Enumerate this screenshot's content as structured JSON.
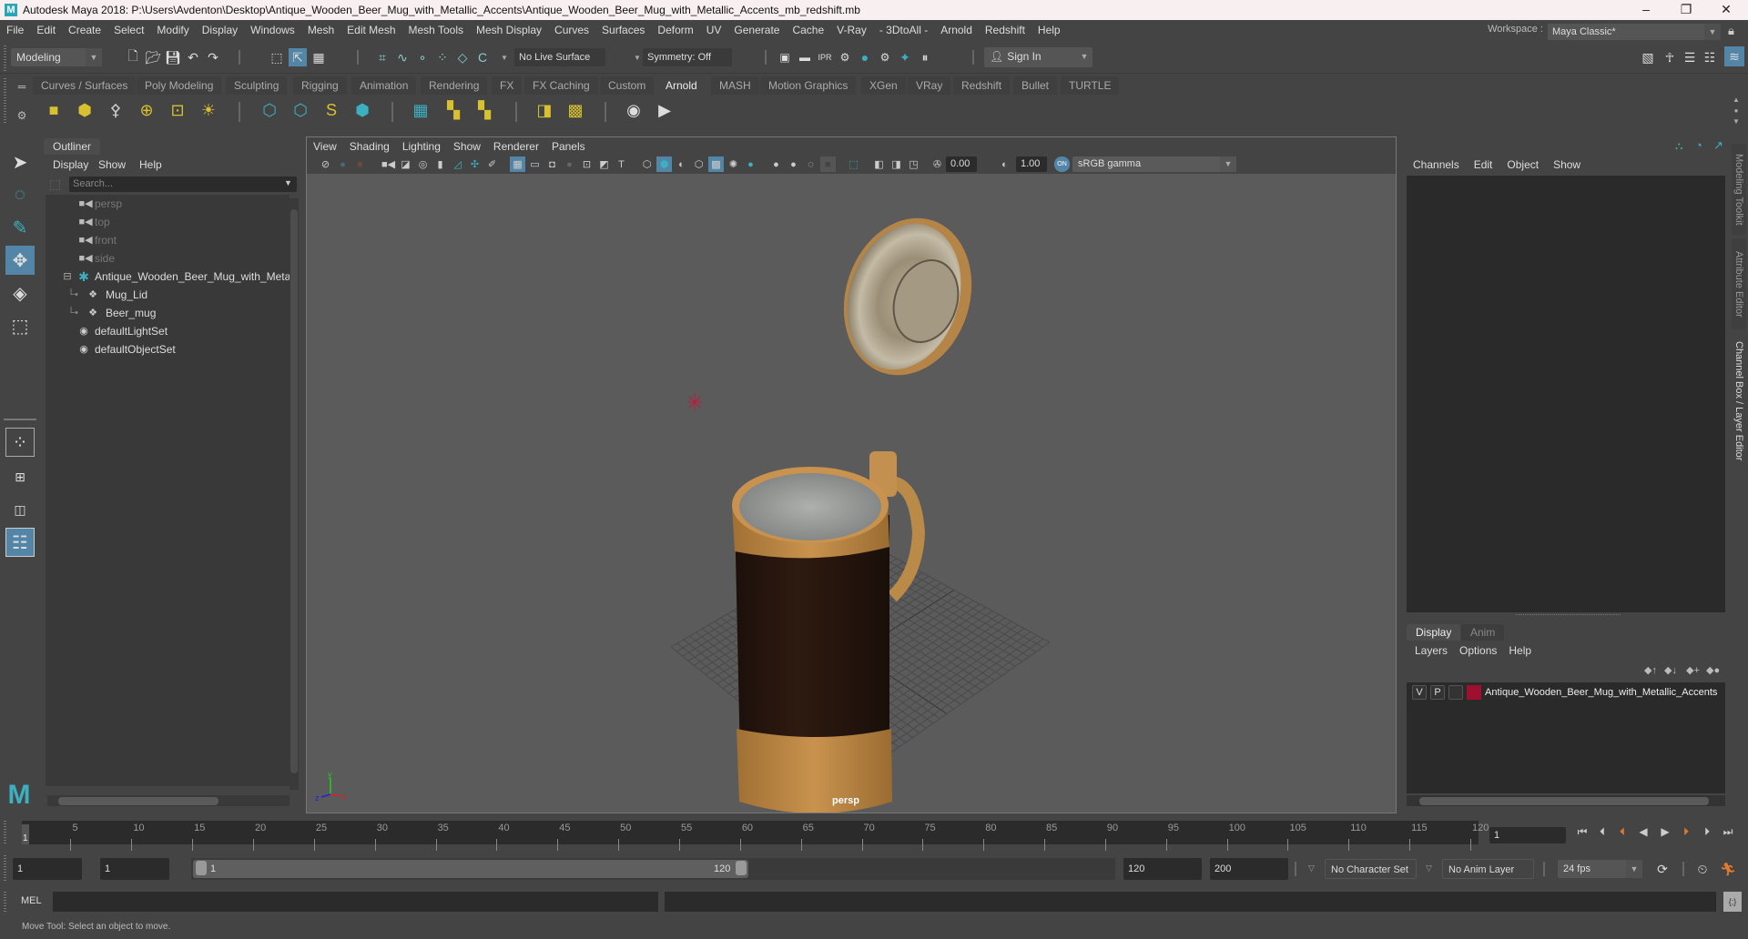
{
  "window": {
    "title": "Autodesk Maya 2018: P:\\Users\\Avdenton\\Desktop\\Antique_Wooden_Beer_Mug_with_Metallic_Accents\\Antique_Wooden_Beer_Mug_with_Metallic_Accents_mb_redshift.mb",
    "logo": "M",
    "controls": {
      "minimize": "–",
      "maximize": "❐",
      "close": "✕"
    }
  },
  "menubar": {
    "items": [
      "File",
      "Edit",
      "Create",
      "Select",
      "Modify",
      "Display",
      "Windows",
      "Mesh",
      "Edit Mesh",
      "Mesh Tools",
      "Mesh Display",
      "Curves",
      "Surfaces",
      "Deform",
      "UV",
      "Generate",
      "Cache",
      "V-Ray",
      "- 3DtoAll -",
      "Arnold",
      "Redshift",
      "Help"
    ],
    "workspace_label": "Workspace :",
    "workspace_value": "Maya Classic*"
  },
  "statusline": {
    "menuset": "Modeling",
    "live_surface": "No Live Surface",
    "symmetry": "Symmetry: Off",
    "sign_in": "Sign In"
  },
  "shelf": {
    "tabs": [
      "Curves / Surfaces",
      "Poly Modeling",
      "Sculpting",
      "Rigging",
      "Animation",
      "Rendering",
      "FX",
      "FX Caching",
      "Custom",
      "Arnold",
      "MASH",
      "Motion Graphics",
      "XGen",
      "VRay",
      "Redshift",
      "Bullet",
      "TURTLE"
    ],
    "active_tab": "Arnold"
  },
  "outliner": {
    "title": "Outliner",
    "menu": [
      "Display",
      "Show",
      "Help"
    ],
    "search_placeholder": "Search...",
    "items": [
      {
        "label": "persp",
        "type": "camera",
        "dim": true
      },
      {
        "label": "top",
        "type": "camera",
        "dim": true
      },
      {
        "label": "front",
        "type": "camera",
        "dim": true
      },
      {
        "label": "side",
        "type": "camera",
        "dim": true
      },
      {
        "label": "Antique_Wooden_Beer_Mug_with_Metallic_Accents",
        "type": "group",
        "expanded": true
      },
      {
        "label": "Mug_Lid",
        "type": "mesh",
        "child": true
      },
      {
        "label": "Beer_mug",
        "type": "mesh",
        "child": true
      },
      {
        "label": "defaultLightSet",
        "type": "set"
      },
      {
        "label": "defaultObjectSet",
        "type": "set"
      }
    ]
  },
  "viewport": {
    "menu": [
      "View",
      "Shading",
      "Lighting",
      "Show",
      "Renderer",
      "Panels"
    ],
    "exposure": "0.00",
    "gamma": "1.00",
    "color_space": "sRGB gamma",
    "color_mgmt_badge": "ON",
    "camera_label": "persp",
    "axis": {
      "x": "x",
      "y": "y",
      "z": "z"
    }
  },
  "channelbox": {
    "menu": [
      "Channels",
      "Edit",
      "Object",
      "Show"
    ],
    "layer_tabs": [
      "Display",
      "Anim"
    ],
    "active_layer_tab": "Display",
    "layer_menu": [
      "Layers",
      "Options",
      "Help"
    ],
    "layers": [
      {
        "v": "V",
        "p": "P",
        "color": "#a0102e",
        "name": "Antique_Wooden_Beer_Mug_with_Metallic_Accents"
      }
    ]
  },
  "side_tabs": [
    "Modeling Toolkit",
    "Attribute Editor",
    "Channel Box / Layer Editor"
  ],
  "active_side_tab": "Channel Box / Layer Editor",
  "timeline": {
    "ticks": [
      5,
      10,
      15,
      20,
      25,
      30,
      35,
      40,
      45,
      50,
      55,
      60,
      65,
      70,
      75,
      80,
      85,
      90,
      95,
      100,
      105,
      110,
      115,
      120
    ],
    "start": 1,
    "end": 120,
    "current_frame": "1",
    "current_frame_field": "1"
  },
  "range": {
    "start_field": "1",
    "playback_start_field": "1",
    "range_start_label": "1",
    "range_end_label": "120",
    "playback_end_field": "120",
    "end_field": "200",
    "character_set": "No Character Set",
    "anim_layer": "No Anim Layer",
    "fps": "24 fps"
  },
  "cmdline": {
    "lang": "MEL"
  },
  "helpline": {
    "text": "Move Tool: Select an object to move."
  }
}
